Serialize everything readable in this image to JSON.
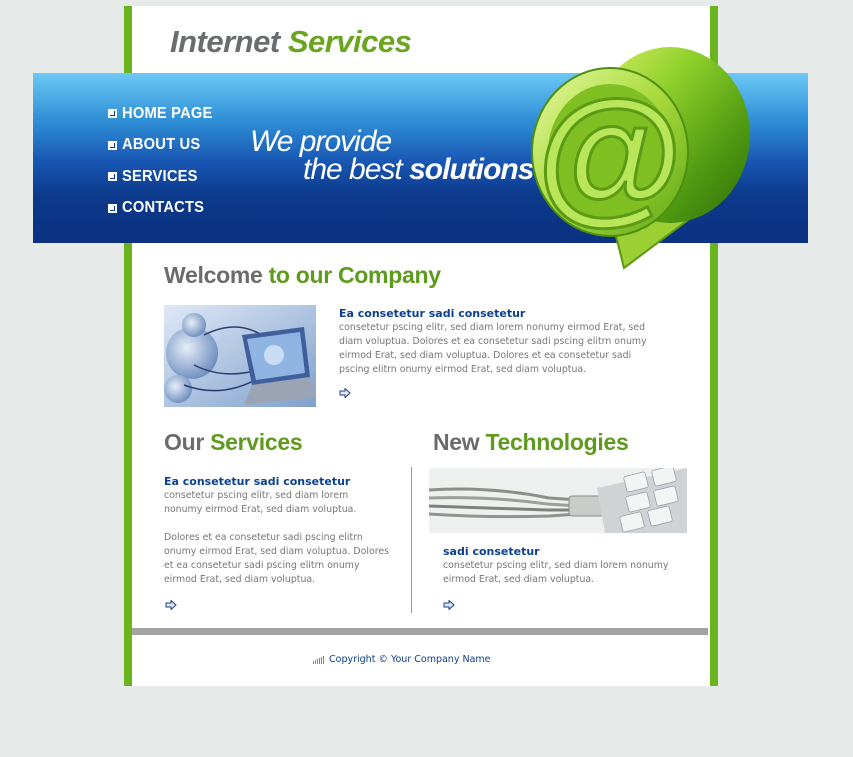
{
  "header": {
    "logo_part1": "Internet",
    "logo_part2": "Services"
  },
  "nav": {
    "items": [
      "HOME PAGE",
      "ABOUT US",
      "SERVICES",
      "CONTACTS"
    ]
  },
  "banner": {
    "tagline_line1": "We provide",
    "tagline_line2_light": "the best ",
    "tagline_line2_bold": "solutions"
  },
  "welcome": {
    "title_gray": "Welcome",
    "title_green": "to our Company",
    "subtitle": "Ea consetetur sadi consetetur",
    "text": "consetetur pscing elitr, sed diam lorem nonumy eirmod Erat, sed diam voluptua. Dolores et ea consetetur sadi pscing elitrn onumy eirmod Erat, sed diam voluptua. Dolores et ea consetetur sadi pscing elitrn onumy eirmod Erat, sed diam voluptua."
  },
  "services": {
    "title_gray": "Our",
    "title_green": "Services",
    "subtitle": "Ea consetetur sadi consetetur",
    "text1": "consetetur pscing elitr, sed diam lorem nonumy eirmod Erat, sed diam voluptua.",
    "text2": "Dolores et ea consetetur sadi pscing elitrn onumy eirmod Erat, sed diam voluptua. Dolores et ea consetetur sadi pscing elitrn onumy eirmod Erat, sed diam voluptua."
  },
  "technologies": {
    "title_gray": "New",
    "title_green": "Technologies",
    "subtitle": "sadi consetetur",
    "text": "consetetur pscing elitr, sed diam lorem nonumy eirmod Erat, sed diam voluptua."
  },
  "footer": {
    "copyright": "Copyright © Your Company Name"
  },
  "colors": {
    "green": "#6ab51f",
    "blue_dark": "#0b3180",
    "heading_green": "#5e9a1c",
    "link_blue": "#0b3f8f"
  }
}
